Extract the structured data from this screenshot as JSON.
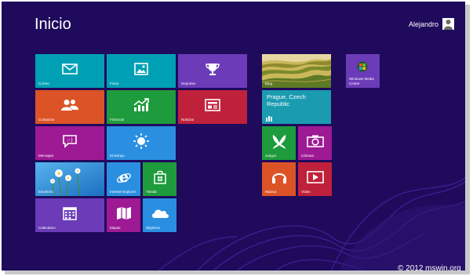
{
  "screen": {
    "title": "Inicio",
    "user": "Alejandro"
  },
  "tiles": {
    "correo": "Correo",
    "fotos": "Fotos",
    "deportes": "Deportes",
    "bing": "Bing",
    "wmc": "Windows Media Center",
    "contactos": "Contactos",
    "finanzas": "Finanzas",
    "noticias": "Noticias",
    "weather_city": "Prague, Czech Republic",
    "mensajes": "Mensajes",
    "tiempo": "El tiempo",
    "juegos": "Juegos",
    "camara": "Cámara",
    "escritorio": "Escritorio",
    "ie": "Internet Explorer",
    "tienda": "Tienda",
    "musica": "Música",
    "video": "Vídeo",
    "calendario": "Calendario",
    "mapas": "Mapas",
    "skydrive": "SkyDrive"
  },
  "watermark": "© 2012 mswin.org",
  "colors": {
    "background": "#1f0a5c",
    "teal": "#00a0b4",
    "purple": "#6b3bb8",
    "orange": "#dc5327",
    "green": "#1e9b3c",
    "red": "#c0213a",
    "magenta": "#9e1a94",
    "blue": "#2a8fe0",
    "skyblue": "#3fa3e6"
  },
  "icons": {
    "correo": "envelope-icon",
    "fotos": "photo-icon",
    "deportes": "trophy-icon",
    "contactos": "people-icon",
    "finanzas": "chart-icon",
    "noticias": "news-icon",
    "mensajes": "chat-icon",
    "tiempo": "sun-icon",
    "juegos": "game-controller-icon",
    "camara": "camera-icon",
    "ie": "internet-explorer-icon",
    "tienda": "shopping-bag-icon",
    "musica": "headphones-icon",
    "video": "play-icon",
    "calendario": "calendar-icon",
    "mapas": "map-icon",
    "skydrive": "cloud-icon"
  }
}
